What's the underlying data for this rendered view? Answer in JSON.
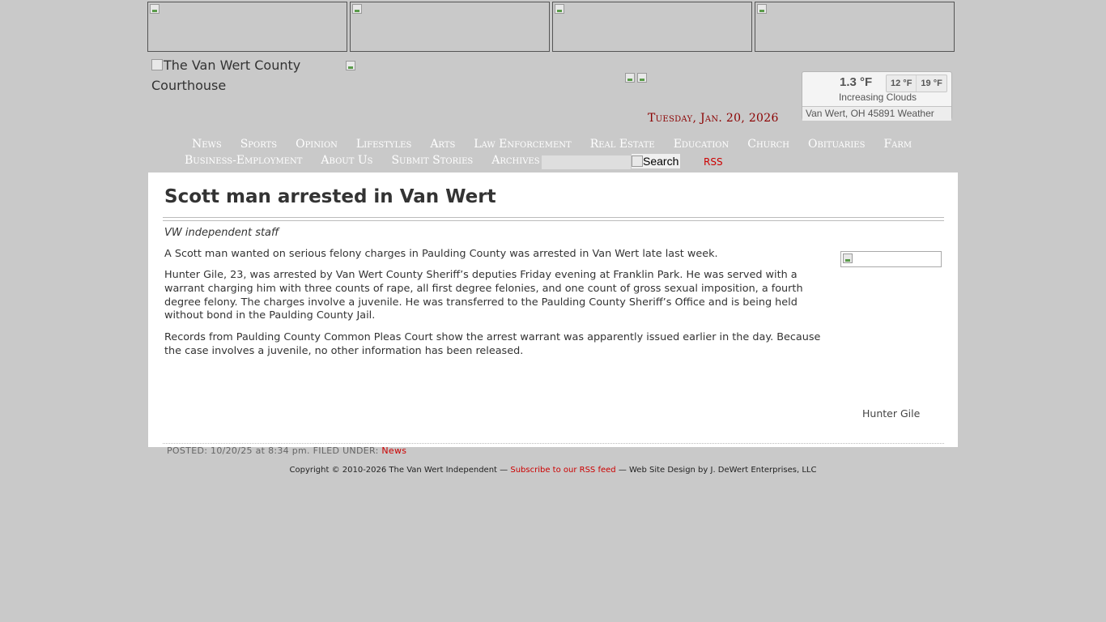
{
  "header": {
    "logo_alt": "The Van Wert County Courthouse",
    "date": "Tuesday, Jan. 20, 2026"
  },
  "weather": {
    "temp": "1.3 °F",
    "low": "12 °F",
    "high": "19 °F",
    "condition": "Increasing Clouds",
    "location": "Van Wert, OH 45891 Weather"
  },
  "nav": {
    "row1": [
      "News",
      "Sports",
      "Opinion",
      "Lifestyles",
      "Arts",
      "Law Enforcement",
      "Real Estate",
      "Education",
      "Church",
      "Obituaries",
      "Farm"
    ],
    "row2": [
      "Business-Employment",
      "About Us",
      "Submit Stories",
      "Archives"
    ],
    "search_button_alt": "Search",
    "rss_label": "RSS"
  },
  "article": {
    "title": "Scott man arrested in Van Wert",
    "byline": "VW independent staff",
    "paragraphs": [
      "A Scott man wanted on serious felony charges in Paulding County was arrested in Van Wert late last week.",
      "Hunter Gile, 23, was arrested by Van Wert County Sheriff’s deputies Friday evening at Franklin Park. He was served with a warrant charging him with three counts of rape, all first degree felonies, and one count of gross sexual imposition, a fourth degree felony. The charges involve a juvenile. He was transferred to the Paulding County Sheriff’s Office and is being held without bond in the Paulding County Jail.",
      "Records from Paulding County Common Pleas Court show the arrest warrant was apparently issued earlier in the day. Because the case involves a juvenile, no other information has been released."
    ],
    "photo_caption": "Hunter Gile"
  },
  "footer": {
    "posted_prefix": "POSTED: 10/20/25 at 8:34 pm. FILED UNDER:",
    "category": "News",
    "copyright_prefix": "Copyright © 2010-2026 The Van Wert Independent —",
    "rss_feed_link": "Subscribe to our RSS feed",
    "copyright_suffix": "— Web Site Design by J. DeWert Enterprises, LLC"
  }
}
